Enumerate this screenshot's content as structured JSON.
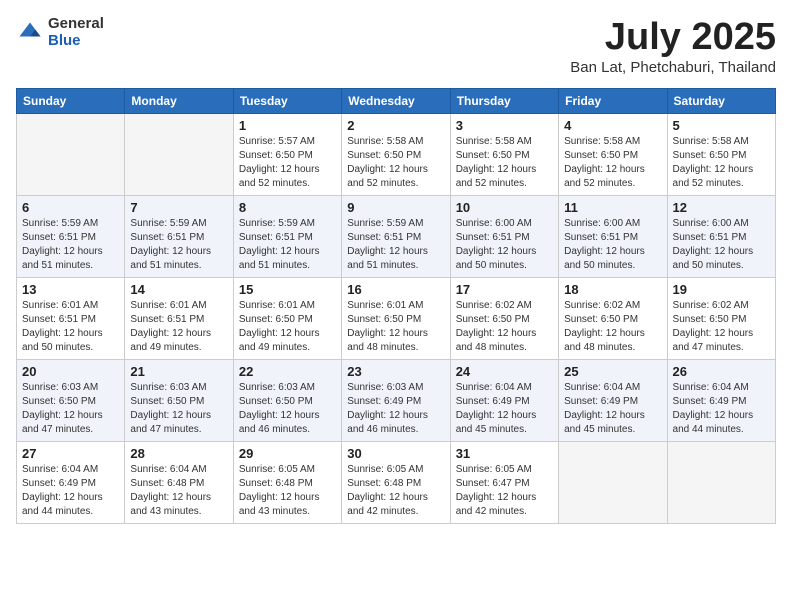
{
  "header": {
    "logo_general": "General",
    "logo_blue": "Blue",
    "title": "July 2025",
    "subtitle": "Ban Lat, Phetchaburi, Thailand"
  },
  "weekdays": [
    "Sunday",
    "Monday",
    "Tuesday",
    "Wednesday",
    "Thursday",
    "Friday",
    "Saturday"
  ],
  "weeks": [
    [
      {
        "day": "",
        "empty": true
      },
      {
        "day": "",
        "empty": true
      },
      {
        "day": "1",
        "sunrise": "5:57 AM",
        "sunset": "6:50 PM",
        "daylight": "12 hours and 52 minutes."
      },
      {
        "day": "2",
        "sunrise": "5:58 AM",
        "sunset": "6:50 PM",
        "daylight": "12 hours and 52 minutes."
      },
      {
        "day": "3",
        "sunrise": "5:58 AM",
        "sunset": "6:50 PM",
        "daylight": "12 hours and 52 minutes."
      },
      {
        "day": "4",
        "sunrise": "5:58 AM",
        "sunset": "6:50 PM",
        "daylight": "12 hours and 52 minutes."
      },
      {
        "day": "5",
        "sunrise": "5:58 AM",
        "sunset": "6:50 PM",
        "daylight": "12 hours and 52 minutes."
      }
    ],
    [
      {
        "day": "6",
        "sunrise": "5:59 AM",
        "sunset": "6:51 PM",
        "daylight": "12 hours and 51 minutes."
      },
      {
        "day": "7",
        "sunrise": "5:59 AM",
        "sunset": "6:51 PM",
        "daylight": "12 hours and 51 minutes."
      },
      {
        "day": "8",
        "sunrise": "5:59 AM",
        "sunset": "6:51 PM",
        "daylight": "12 hours and 51 minutes."
      },
      {
        "day": "9",
        "sunrise": "5:59 AM",
        "sunset": "6:51 PM",
        "daylight": "12 hours and 51 minutes."
      },
      {
        "day": "10",
        "sunrise": "6:00 AM",
        "sunset": "6:51 PM",
        "daylight": "12 hours and 50 minutes."
      },
      {
        "day": "11",
        "sunrise": "6:00 AM",
        "sunset": "6:51 PM",
        "daylight": "12 hours and 50 minutes."
      },
      {
        "day": "12",
        "sunrise": "6:00 AM",
        "sunset": "6:51 PM",
        "daylight": "12 hours and 50 minutes."
      }
    ],
    [
      {
        "day": "13",
        "sunrise": "6:01 AM",
        "sunset": "6:51 PM",
        "daylight": "12 hours and 50 minutes."
      },
      {
        "day": "14",
        "sunrise": "6:01 AM",
        "sunset": "6:51 PM",
        "daylight": "12 hours and 49 minutes."
      },
      {
        "day": "15",
        "sunrise": "6:01 AM",
        "sunset": "6:50 PM",
        "daylight": "12 hours and 49 minutes."
      },
      {
        "day": "16",
        "sunrise": "6:01 AM",
        "sunset": "6:50 PM",
        "daylight": "12 hours and 48 minutes."
      },
      {
        "day": "17",
        "sunrise": "6:02 AM",
        "sunset": "6:50 PM",
        "daylight": "12 hours and 48 minutes."
      },
      {
        "day": "18",
        "sunrise": "6:02 AM",
        "sunset": "6:50 PM",
        "daylight": "12 hours and 48 minutes."
      },
      {
        "day": "19",
        "sunrise": "6:02 AM",
        "sunset": "6:50 PM",
        "daylight": "12 hours and 47 minutes."
      }
    ],
    [
      {
        "day": "20",
        "sunrise": "6:03 AM",
        "sunset": "6:50 PM",
        "daylight": "12 hours and 47 minutes."
      },
      {
        "day": "21",
        "sunrise": "6:03 AM",
        "sunset": "6:50 PM",
        "daylight": "12 hours and 47 minutes."
      },
      {
        "day": "22",
        "sunrise": "6:03 AM",
        "sunset": "6:50 PM",
        "daylight": "12 hours and 46 minutes."
      },
      {
        "day": "23",
        "sunrise": "6:03 AM",
        "sunset": "6:49 PM",
        "daylight": "12 hours and 46 minutes."
      },
      {
        "day": "24",
        "sunrise": "6:04 AM",
        "sunset": "6:49 PM",
        "daylight": "12 hours and 45 minutes."
      },
      {
        "day": "25",
        "sunrise": "6:04 AM",
        "sunset": "6:49 PM",
        "daylight": "12 hours and 45 minutes."
      },
      {
        "day": "26",
        "sunrise": "6:04 AM",
        "sunset": "6:49 PM",
        "daylight": "12 hours and 44 minutes."
      }
    ],
    [
      {
        "day": "27",
        "sunrise": "6:04 AM",
        "sunset": "6:49 PM",
        "daylight": "12 hours and 44 minutes."
      },
      {
        "day": "28",
        "sunrise": "6:04 AM",
        "sunset": "6:48 PM",
        "daylight": "12 hours and 43 minutes."
      },
      {
        "day": "29",
        "sunrise": "6:05 AM",
        "sunset": "6:48 PM",
        "daylight": "12 hours and 43 minutes."
      },
      {
        "day": "30",
        "sunrise": "6:05 AM",
        "sunset": "6:48 PM",
        "daylight": "12 hours and 42 minutes."
      },
      {
        "day": "31",
        "sunrise": "6:05 AM",
        "sunset": "6:47 PM",
        "daylight": "12 hours and 42 minutes."
      },
      {
        "day": "",
        "empty": true
      },
      {
        "day": "",
        "empty": true
      }
    ]
  ],
  "labels": {
    "sunrise": "Sunrise:",
    "sunset": "Sunset:",
    "daylight": "Daylight:"
  }
}
